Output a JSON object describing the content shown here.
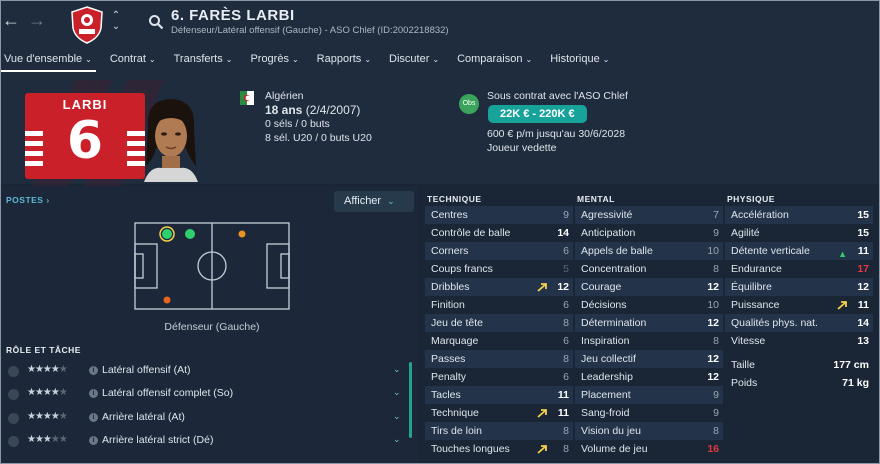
{
  "header": {
    "player_name": "6. FARÈS LARBI",
    "player_sub": "Défenseur/Latéral offensif (Gauche) - ASO Chlef (ID:2002218832)",
    "tabs": [
      {
        "label": "Vue d'ensemble"
      },
      {
        "label": "Contrat"
      },
      {
        "label": "Transferts"
      },
      {
        "label": "Progrès"
      },
      {
        "label": "Rapports"
      },
      {
        "label": "Discuter"
      },
      {
        "label": "Comparaison"
      },
      {
        "label": "Historique"
      }
    ]
  },
  "shirt": {
    "name": "LARBI",
    "number": "6"
  },
  "bio": {
    "nationality": "Algérien",
    "age_bold": "18 ans",
    "birth": "(2/4/2007)",
    "caps": "0 séls / 0 buts",
    "caps_u20": "8 sél. U20 / 0 buts U20"
  },
  "contract": {
    "obs_badge": "Obs",
    "club_line": "Sous contrat avec l'ASO Chlef",
    "wage_range": "22K € - 220K €",
    "wage_detail": "600 € p/m jusqu'au 30/6/2028",
    "status": "Joueur vedette"
  },
  "positions": {
    "title": "POSTES",
    "afficher": "Afficher",
    "position_label": "Défenseur (Gauche)"
  },
  "roles": {
    "title": "RÔLE ET TÂCHE",
    "items": [
      {
        "name": "Latéral offensif (At)",
        "stars": 4.5
      },
      {
        "name": "Latéral offensif complet (So)",
        "stars": 4.5
      },
      {
        "name": "Arrière latéral (At)",
        "stars": 4.5
      },
      {
        "name": "Arrière latéral strict (Dé)",
        "stars": 4
      }
    ]
  },
  "technique": {
    "title": "TECHNIQUE",
    "rows": [
      {
        "label": "Centres",
        "value": "9"
      },
      {
        "label": "Contrôle de balle",
        "value": "14"
      },
      {
        "label": "Corners",
        "value": "6"
      },
      {
        "label": "Coups francs",
        "value": "5"
      },
      {
        "label": "Dribbles",
        "value": "12"
      },
      {
        "label": "Finition",
        "value": "6"
      },
      {
        "label": "Jeu de tête",
        "value": "8"
      },
      {
        "label": "Marquage",
        "value": "6"
      },
      {
        "label": "Passes",
        "value": "8"
      },
      {
        "label": "Penalty",
        "value": "6"
      },
      {
        "label": "Tacles",
        "value": "11"
      },
      {
        "label": "Technique",
        "value": "11"
      },
      {
        "label": "Tirs de loin",
        "value": "8"
      },
      {
        "label": "Touches longues",
        "value": "8"
      }
    ]
  },
  "mental": {
    "title": "MENTAL",
    "rows": [
      {
        "label": "Agressivité",
        "value": "7"
      },
      {
        "label": "Anticipation",
        "value": "9"
      },
      {
        "label": "Appels de balle",
        "value": "10"
      },
      {
        "label": "Concentration",
        "value": "8"
      },
      {
        "label": "Courage",
        "value": "12"
      },
      {
        "label": "Décisions",
        "value": "10"
      },
      {
        "label": "Détermination",
        "value": "12"
      },
      {
        "label": "Inspiration",
        "value": "8"
      },
      {
        "label": "Jeu collectif",
        "value": "12"
      },
      {
        "label": "Leadership",
        "value": "12"
      },
      {
        "label": "Placement",
        "value": "9"
      },
      {
        "label": "Sang-froid",
        "value": "9"
      },
      {
        "label": "Vision du jeu",
        "value": "8"
      },
      {
        "label": "Volume de jeu",
        "value": "16"
      }
    ]
  },
  "physique": {
    "title": "PHYSIQUE",
    "rows": [
      {
        "label": "Accélération",
        "value": "15"
      },
      {
        "label": "Agilité",
        "value": "15"
      },
      {
        "label": "Détente verticale",
        "value": "11"
      },
      {
        "label": "Endurance",
        "value": "17"
      },
      {
        "label": "Équilibre",
        "value": "12"
      },
      {
        "label": "Puissance",
        "value": "11"
      },
      {
        "label": "Qualités phys. nat.",
        "value": "14"
      },
      {
        "label": "Vitesse",
        "value": "13"
      }
    ],
    "height_label": "Taille",
    "height_value": "177 cm",
    "weight_label": "Poids",
    "weight_value": "71 kg"
  },
  "colors": {
    "accent": "#17a39a",
    "red_value": "#e2383f",
    "background": "#1a2636"
  }
}
